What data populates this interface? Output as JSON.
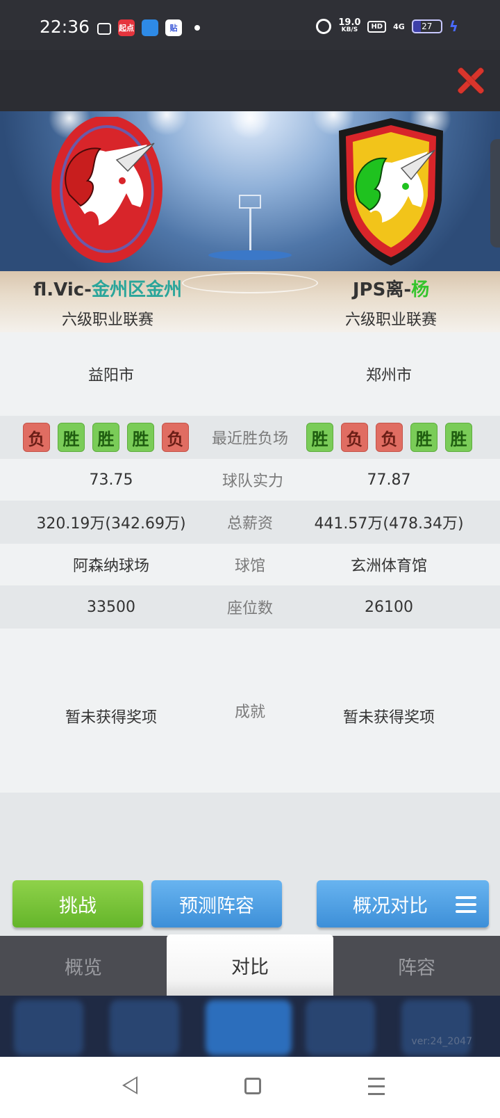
{
  "status_bar": {
    "time": "22:36",
    "network_speed": "19.0",
    "network_unit": "KB/S",
    "hd": "HD",
    "signal": "4G",
    "battery": "27",
    "notification_icons": [
      "bilibili-icon",
      "qidian-app-icon",
      "blue-app-icon",
      "tieba-icon",
      "dot-icon"
    ],
    "qidian_label": "起点",
    "tieba_label": "贴"
  },
  "team_left": {
    "name_prefix": "fl.Vic-",
    "name_highlight": "金州区金州",
    "league": "六级职业联赛",
    "city": "益阳市",
    "recent": [
      "负",
      "胜",
      "胜",
      "胜",
      "负"
    ],
    "strength": "73.75",
    "salary": "320.19万(342.69万)",
    "arena": "阿森纳球场",
    "seats": "33500",
    "achievement": "暂未获得奖项",
    "logo_colors": {
      "ring": "#d8252a",
      "horse": "#ffffff",
      "mane": "#c81e1e"
    }
  },
  "team_right": {
    "name_prefix": "JPS离-",
    "name_highlight": "杨",
    "league": "六级职业联赛",
    "city": "郑州市",
    "recent": [
      "胜",
      "负",
      "负",
      "胜",
      "胜"
    ],
    "strength": "77.87",
    "salary": "441.57万(478.34万)",
    "arena": "玄洲体育馆",
    "seats": "26100",
    "achievement": "暂未获得奖项",
    "logo_colors": {
      "shield": "#f2c41a",
      "border": "#d8252a",
      "mane": "#1fc21f"
    }
  },
  "labels": {
    "recent": "最近胜负场",
    "strength": "球队实力",
    "salary": "总薪资",
    "arena": "球馆",
    "seats": "座位数",
    "achievement": "成就"
  },
  "buttons": {
    "challenge": "挑战",
    "predict": "预测阵容",
    "compare": "概况对比"
  },
  "tabs": [
    "概览",
    "对比",
    "阵容"
  ],
  "active_tab": "对比",
  "version": "ver:24_2047",
  "colors": {
    "win": "#7acc58",
    "loss": "#e06d62",
    "teal_highlight": "#2aa59a",
    "green_highlight": "#35c42d",
    "close": "#d9352c"
  }
}
